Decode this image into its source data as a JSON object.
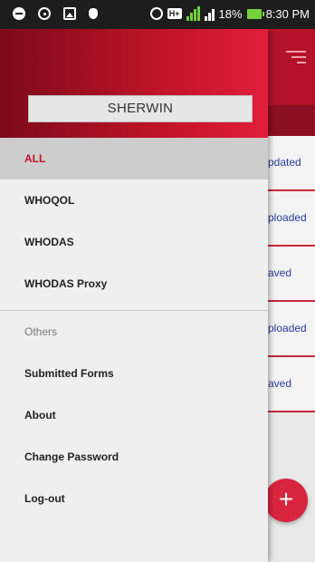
{
  "statusbar": {
    "battery_text": "18%",
    "time": "8:30 PM",
    "network_badge": "H+"
  },
  "drawer": {
    "username": "SHERWIN",
    "items": [
      {
        "label": "ALL"
      },
      {
        "label": "WHOQOL"
      },
      {
        "label": "WHODAS"
      },
      {
        "label": "WHODAS Proxy"
      }
    ],
    "section_label": "Others",
    "other_items": [
      {
        "label": "Submitted Forms"
      },
      {
        "label": "About"
      },
      {
        "label": "Change Password"
      },
      {
        "label": "Log-out"
      }
    ]
  },
  "background_list": [
    {
      "status": "pdated"
    },
    {
      "status": "ploaded"
    },
    {
      "status": "aved"
    },
    {
      "status": "ploaded"
    },
    {
      "status": "aved"
    }
  ],
  "fab": {
    "label": "+"
  },
  "colors": {
    "accent": "#c0122a",
    "header": "#b3122a",
    "link": "#2a3c9a"
  }
}
